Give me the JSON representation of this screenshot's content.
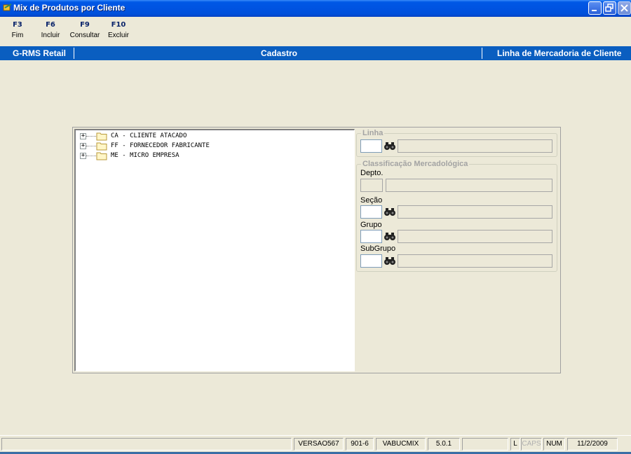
{
  "window": {
    "title": "Mix de Produtos por Cliente",
    "icon": "app-icon"
  },
  "toolbar": {
    "keys": [
      {
        "key": "F3",
        "label": "Fim"
      },
      {
        "key": "F6",
        "label": "Incluir"
      },
      {
        "key": "F9",
        "label": "Consultar"
      },
      {
        "key": "F10",
        "label": "Excluir"
      }
    ]
  },
  "header": {
    "left": "G-RMS Retail",
    "center": "Cadastro",
    "right": "Linha de Mercadoria de Cliente"
  },
  "tree": {
    "items": [
      {
        "expander": "+",
        "label": "CA - CLIENTE ATACADO"
      },
      {
        "expander": "+",
        "label": "FF - FORNECEDOR FABRICANTE"
      },
      {
        "expander": "+",
        "label": "ME - MICRO EMPRESA"
      }
    ]
  },
  "linha": {
    "legend": "Linha",
    "code": "",
    "description": ""
  },
  "classificacao": {
    "legend": "Classificação Mercadológica",
    "depto_label": "Depto.",
    "secao_label": "Seção",
    "grupo_label": "Grupo",
    "subgrupo_label": "SubGrupo"
  },
  "statusbar": {
    "panels": [
      "",
      "VERSAO567",
      "901-6",
      "VABUCMIX",
      "5.0.1",
      "",
      "L",
      "CAPS",
      "NUM",
      "11/2/2009"
    ]
  },
  "colors": {
    "titlebar": "#0054E3",
    "header": "#0A5EC0",
    "window_bg": "#ECE9D8",
    "toolbar_key": "#0A246A"
  }
}
